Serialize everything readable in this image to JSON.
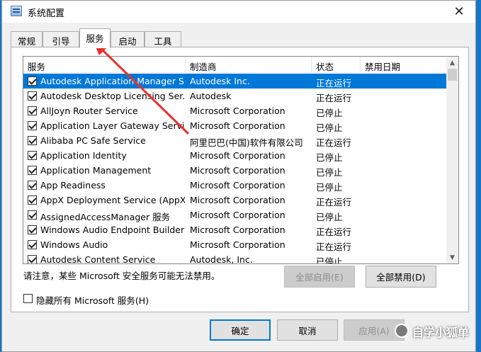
{
  "window": {
    "title": "系统配置",
    "close_glyph": "✕"
  },
  "tabs": [
    {
      "label": "常规",
      "active": false
    },
    {
      "label": "引导",
      "active": false
    },
    {
      "label": "服务",
      "active": true
    },
    {
      "label": "启动",
      "active": false
    },
    {
      "label": "工具",
      "active": false
    }
  ],
  "columns": {
    "service": "服务",
    "maker": "制造商",
    "status": "状态",
    "disabled_date": "禁用日期"
  },
  "services": [
    {
      "name": "Autodesk Application Manager S...",
      "maker": "Autodesk Inc.",
      "status": "正在运行",
      "date": "",
      "checked": true,
      "selected": true
    },
    {
      "name": "Autodesk Desktop Licensing Ser...",
      "maker": "Autodesk",
      "status": "正在运行",
      "date": "",
      "checked": true,
      "selected": false
    },
    {
      "name": "AllJoyn Router Service",
      "maker": "Microsoft Corporation",
      "status": "已停止",
      "date": "",
      "checked": true,
      "selected": false
    },
    {
      "name": "Application Layer Gateway Service",
      "maker": "Microsoft Corporation",
      "status": "已停止",
      "date": "",
      "checked": true,
      "selected": false
    },
    {
      "name": "Alibaba PC Safe Service",
      "maker": "阿里巴巴(中国)软件有限公司",
      "status": "正在运行",
      "date": "",
      "checked": true,
      "selected": false
    },
    {
      "name": "Application Identity",
      "maker": "Microsoft Corporation",
      "status": "已停止",
      "date": "",
      "checked": true,
      "selected": false
    },
    {
      "name": "Application Management",
      "maker": "Microsoft Corporation",
      "status": "已停止",
      "date": "",
      "checked": true,
      "selected": false
    },
    {
      "name": "App Readiness",
      "maker": "Microsoft Corporation",
      "status": "已停止",
      "date": "",
      "checked": true,
      "selected": false
    },
    {
      "name": "AppX Deployment Service (AppX...",
      "maker": "Microsoft Corporation",
      "status": "正在运行",
      "date": "",
      "checked": true,
      "selected": false
    },
    {
      "name": "AssignedAccessManager 服务",
      "maker": "Microsoft Corporation",
      "status": "已停止",
      "date": "",
      "checked": true,
      "selected": false
    },
    {
      "name": "Windows Audio Endpoint Builder",
      "maker": "Microsoft Corporation",
      "status": "正在运行",
      "date": "",
      "checked": true,
      "selected": false
    },
    {
      "name": "Windows Audio",
      "maker": "Microsoft Corporation",
      "status": "正在运行",
      "date": "",
      "checked": true,
      "selected": false
    },
    {
      "name": "Autodesk Content Service",
      "maker": "Autodesk, Inc.",
      "status": "已停止",
      "date": "",
      "checked": true,
      "selected": false
    }
  ],
  "notice": "请注意，某些 Microsoft 安全服务可能无法禁用。",
  "buttons": {
    "enable_all": "全部启用(E)",
    "disable_all": "全部禁用(D)",
    "ok": "确定",
    "cancel": "取消",
    "apply": "应用(A)"
  },
  "hide_ms": {
    "label": "隐藏所有 Microsoft 服务(H)",
    "checked": false
  },
  "watermark": {
    "text": "自学小狐单"
  },
  "colors": {
    "selection": "#0078d7",
    "annotation_arrow": "#e8322d"
  }
}
